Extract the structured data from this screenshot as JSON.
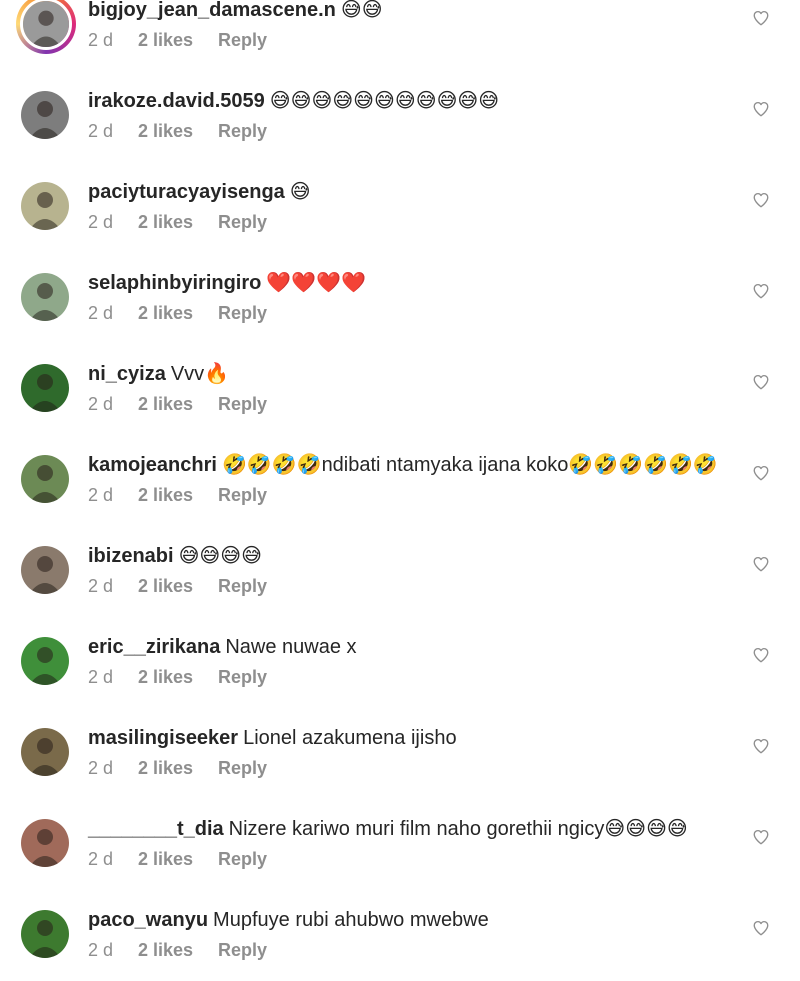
{
  "comments": [
    {
      "username": "bigjoy_jean_damascene.n",
      "text": "😅😅",
      "time": "2 d",
      "likes": "2 likes",
      "reply": "Reply",
      "avatar_color": "#9a9a9a",
      "story_ring": true
    },
    {
      "username": "irakoze.david.5059",
      "text": "😅😅😅😅😅😅😅😅😅😅😅",
      "time": "2 d",
      "likes": "2 likes",
      "reply": "Reply",
      "avatar_color": "#7d7d7d",
      "story_ring": false
    },
    {
      "username": "paciyturacyayisenga",
      "text": "😅",
      "time": "2 d",
      "likes": "2 likes",
      "reply": "Reply",
      "avatar_color": "#b7b38f",
      "story_ring": false
    },
    {
      "username": "selaphinbyiringiro",
      "text": "❤️❤️❤️❤️",
      "time": "2 d",
      "likes": "2 likes",
      "reply": "Reply",
      "avatar_color": "#8fa88a",
      "story_ring": false
    },
    {
      "username": "ni_cyiza",
      "text": "Vvv🔥",
      "time": "2 d",
      "likes": "2 likes",
      "reply": "Reply",
      "avatar_color": "#2f6a2c",
      "story_ring": false
    },
    {
      "username": "kamojeanchri",
      "text": "🤣🤣🤣🤣ndibati ntamyaka ijana koko🤣🤣🤣🤣🤣🤣",
      "time": "2 d",
      "likes": "2 likes",
      "reply": "Reply",
      "avatar_color": "#6c8a55",
      "story_ring": false
    },
    {
      "username": "ibizenabi",
      "text": "😅😅😅😅",
      "time": "2 d",
      "likes": "2 likes",
      "reply": "Reply",
      "avatar_color": "#8a7a6c",
      "story_ring": false
    },
    {
      "username": "eric__zirikana",
      "text": "Nawe nuwae x",
      "time": "2 d",
      "likes": "2 likes",
      "reply": "Reply",
      "avatar_color": "#3f8f3a",
      "story_ring": false
    },
    {
      "username": "masilingiseeker",
      "text": "Lionel azakumena ijisho",
      "time": "2 d",
      "likes": "2 likes",
      "reply": "Reply",
      "avatar_color": "#7a6a4a",
      "story_ring": false
    },
    {
      "username": "________t_dia",
      "text": "Nizere kariwo muri film naho gorethii ngicy😅😅😅😅",
      "time": "2 d",
      "likes": "2 likes",
      "reply": "Reply",
      "avatar_color": "#a06a5a",
      "story_ring": false
    },
    {
      "username": "paco_wanyu",
      "text": "Mupfuye rubi ahubwo mwebwe",
      "time": "2 d",
      "likes": "2 likes",
      "reply": "Reply",
      "avatar_color": "#3d7a2f",
      "story_ring": false
    }
  ]
}
